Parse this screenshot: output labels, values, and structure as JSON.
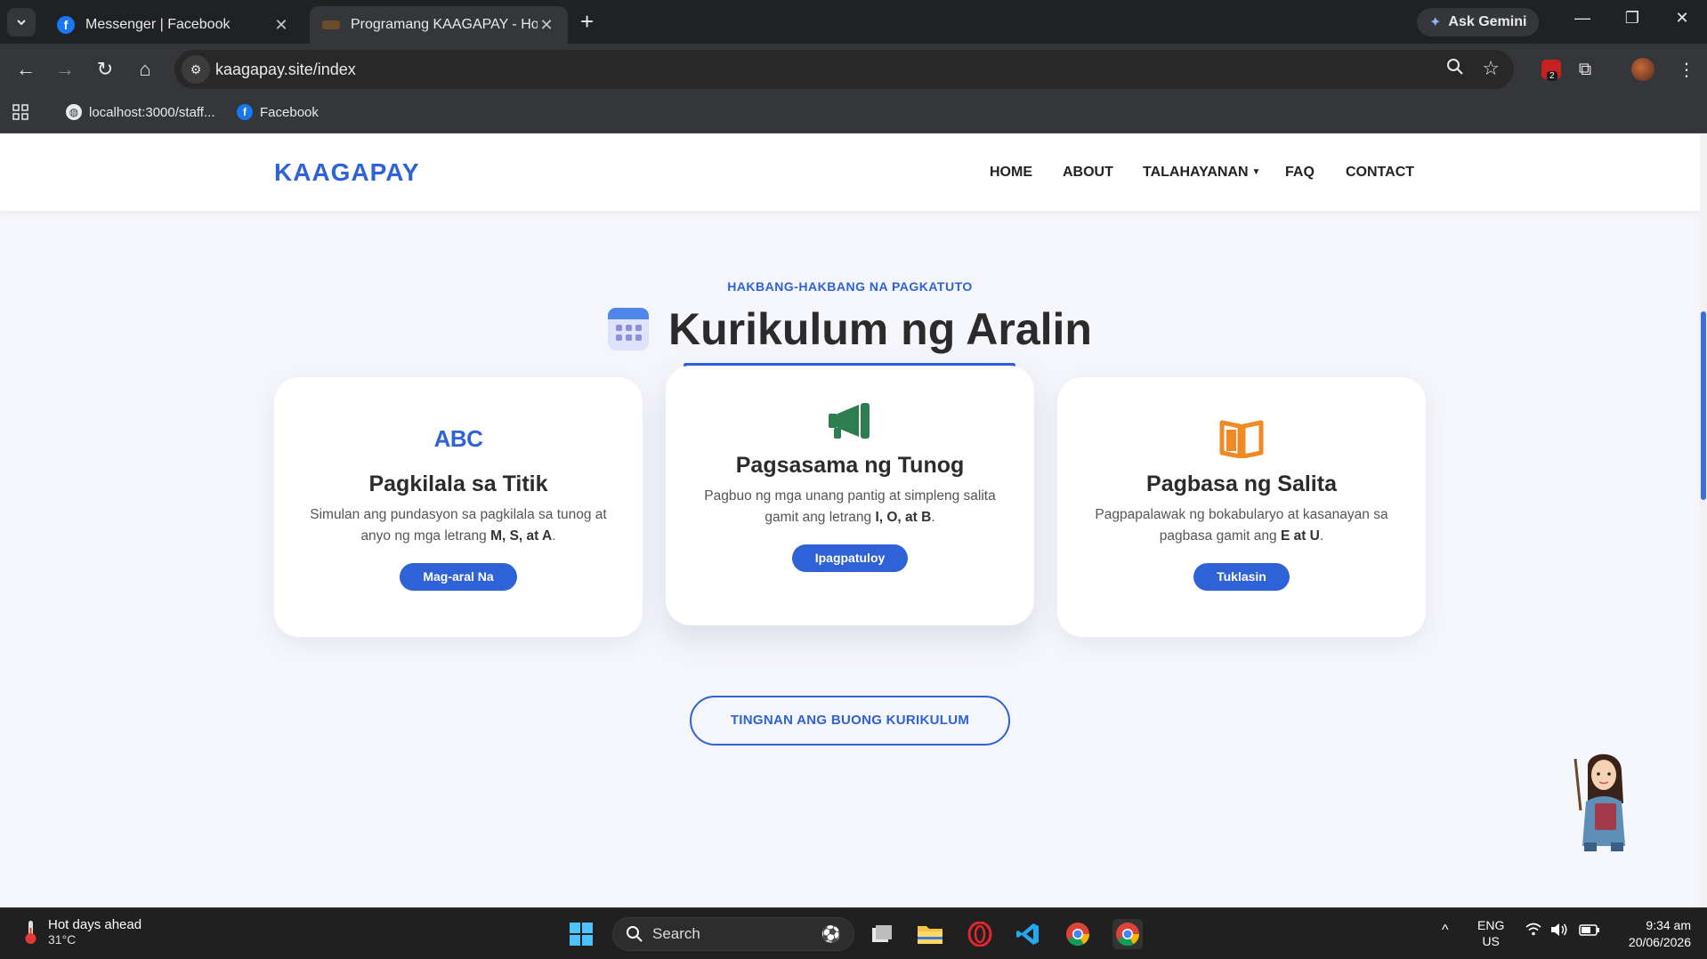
{
  "browser": {
    "tabs": [
      {
        "title": "Messenger | Facebook",
        "active": false
      },
      {
        "title": "Programang KAAGAPAY - Home",
        "active": true
      }
    ],
    "new_tab": "+",
    "gemini_label": "Ask Gemini",
    "url": "kaagapay.site/index",
    "extension_count": "2",
    "bookmarks": [
      {
        "label": "localhost:3000/staff..."
      },
      {
        "label": "Facebook"
      }
    ]
  },
  "site": {
    "brand": "KAAGAPAY",
    "nav": {
      "home": "HOME",
      "about": "ABOUT",
      "talahayanan": "TALAHAYANAN",
      "faq": "FAQ",
      "contact": "CONTACT"
    },
    "section": {
      "eyebrow": "HAKBANG-HAKBANG NA PAGKATUTO",
      "title": "Kurikulum ng Aralin"
    },
    "cards": [
      {
        "icon_text": "ABC",
        "title": "Pagkilala sa Titik",
        "desc_pre": "Simulan ang pundasyon sa pagkilala sa tunog at anyo ng mga letrang ",
        "desc_bold": "M, S, at A",
        "desc_post": ".",
        "button": "Mag-aral Na"
      },
      {
        "icon": "megaphone-icon",
        "title": "Pagsasama ng Tunog",
        "desc_pre": "Pagbuo ng mga unang pantig at simpleng salita gamit ang letrang ",
        "desc_bold": "I, O, at B",
        "desc_post": ".",
        "button": "Ipagpatuloy"
      },
      {
        "icon": "open-book-icon",
        "title": "Pagbasa ng Salita",
        "desc_pre": "Pagpapalawak ng bokabularyo at kasanayan sa pagbasa gamit ang ",
        "desc_bold": "E at U",
        "desc_post": ".",
        "button": "Tuklasin"
      }
    ],
    "curriculum_button": "TINGNAN ANG BUONG KURIKULUM"
  },
  "taskbar": {
    "weather_line1": "Hot days ahead",
    "weather_line2": "31°C",
    "search_label": "Search",
    "lang_line1": "ENG",
    "lang_line2": "US",
    "time": "9:34 am",
    "date": "20/06/2026"
  },
  "colors": {
    "brand_blue": "#2e62d6",
    "megaphone_green": "#2e7d4f",
    "book_orange": "#f08a24",
    "page_bg": "#f5f6fb"
  }
}
